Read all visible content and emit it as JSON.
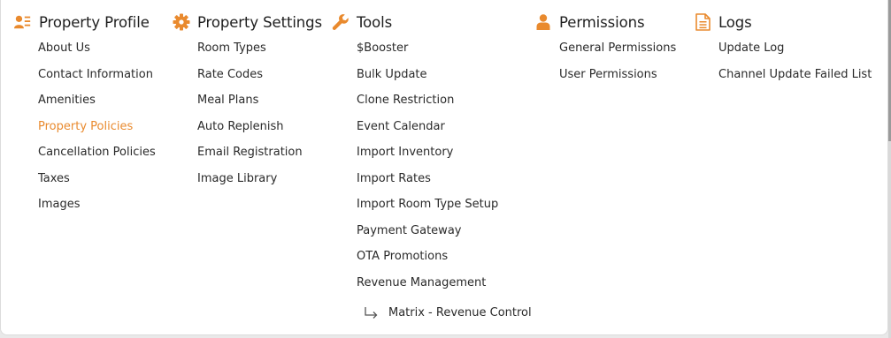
{
  "accent_color": "#e98a2e",
  "columns": [
    {
      "title": "Property Profile",
      "icon": "user-list-icon",
      "items": [
        "About Us",
        "Contact Information",
        "Amenities",
        "Property Policies",
        "Cancellation Policies",
        "Taxes",
        "Images"
      ],
      "active_item": "Property Policies"
    },
    {
      "title": "Property Settings",
      "icon": "gear-icon",
      "items": [
        "Room Types",
        "Rate Codes",
        "Meal Plans",
        "Auto Replenish",
        "Email Registration",
        "Image Library"
      ]
    },
    {
      "title": "Tools",
      "icon": "wrench-icon",
      "items": [
        "$Booster",
        "Bulk Update",
        "Clone Restriction",
        "Event Calendar",
        "Import Inventory",
        "Import Rates",
        "Import Room Type Setup",
        "Payment Gateway",
        "OTA Promotions",
        "Revenue Management"
      ],
      "sub_item": "Matrix - Revenue Control"
    },
    {
      "title": "Permissions",
      "icon": "user-icon",
      "items": [
        "General Permissions",
        "User Permissions"
      ]
    },
    {
      "title": "Logs",
      "icon": "document-icon",
      "items": [
        "Update Log",
        "Channel Update Failed List"
      ]
    }
  ]
}
